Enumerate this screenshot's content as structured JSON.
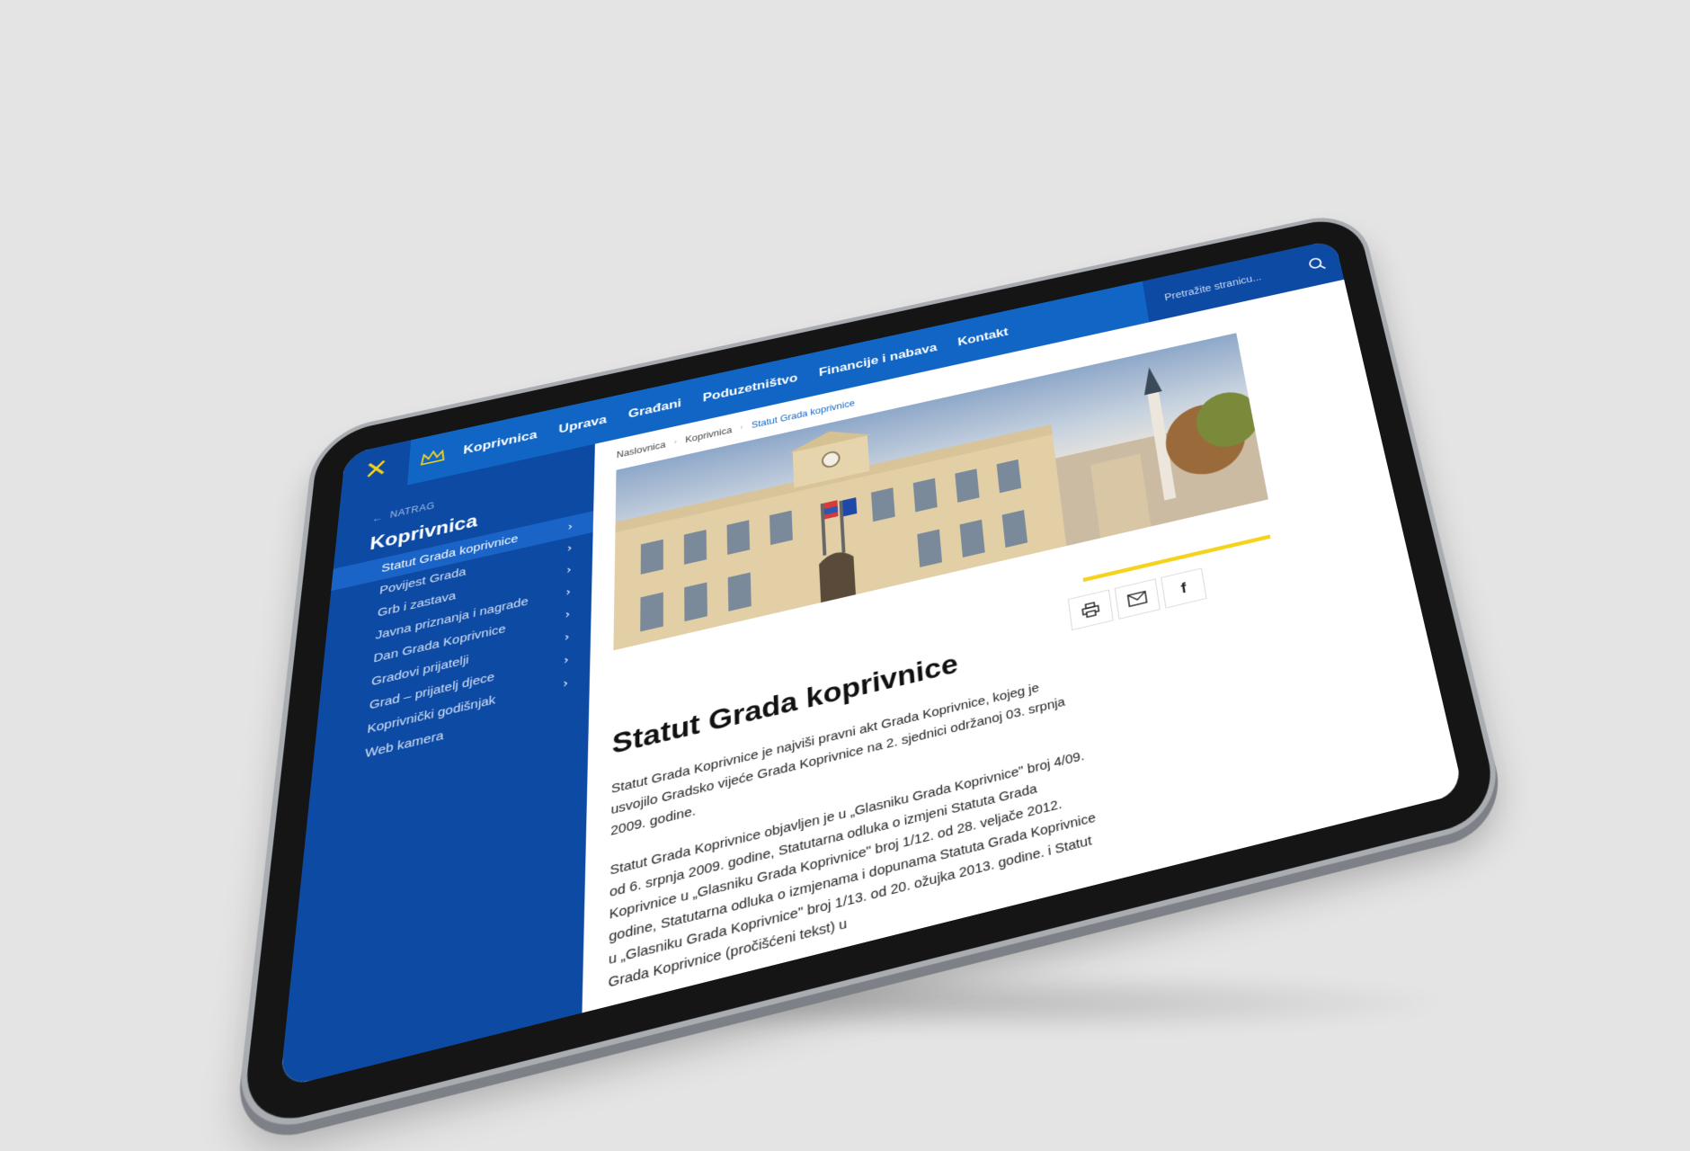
{
  "topbar": {
    "close_icon": "close-icon",
    "logo_icon": "crown-icon",
    "nav": [
      "Koprivnica",
      "Uprava",
      "Građani",
      "Poduzetništvo",
      "Financije i nabava",
      "Kontakt"
    ],
    "search_placeholder": "Pretražite stranicu...",
    "search_icon": "search-icon"
  },
  "sidebar": {
    "back_label": "NATRAG",
    "title": "Koprivnica",
    "items": [
      "Statut Grada koprivnice",
      "Povijest Grada",
      "Grb i zastava",
      "Javna priznanja i nagrade",
      "Dan Grada Koprivnice",
      "Gradovi prijatelji",
      "Grad – prijatelj djece",
      "Koprivnički godišnjak",
      "Web kamera"
    ],
    "active_index": 0
  },
  "breadcrumb": [
    "Naslovnica",
    "Koprivnica",
    "Statut Grada koprivnice"
  ],
  "share_icons": [
    "print-icon",
    "mail-icon",
    "facebook-icon"
  ],
  "article": {
    "title": "Statut Grada koprivnice",
    "paragraphs": [
      "Statut Grada Koprivnice je najviši pravni akt Grada Koprivnice, kojeg je usvojilo Gradsko vijeće Grada Koprivnice na 2. sjednici održanoj 03. srpnja 2009. godine.",
      "Statut Grada Koprivnice objavljen je u „Glasniku Grada Koprivnice\" broj 4/09. od 6. srpnja 2009. godine, Statutarna odluka o izmjeni Statuta Grada Koprivnice u „Glasniku Grada Koprivnice\" broj 1/12. od 28. veljače 2012. godine, Statutarna odluka o izmjenama i dopunama Statuta Grada Koprivnice u „Glasniku Grada Koprivnice\" broj 1/13. od 20. ožujka 2013. godine. i Statut Grada Koprivnice (pročišćeni tekst) u"
    ]
  },
  "colors": {
    "nav_blue": "#1166c5",
    "sidebar_blue": "#0d4aa3",
    "accent_yellow": "#f5d21c"
  }
}
